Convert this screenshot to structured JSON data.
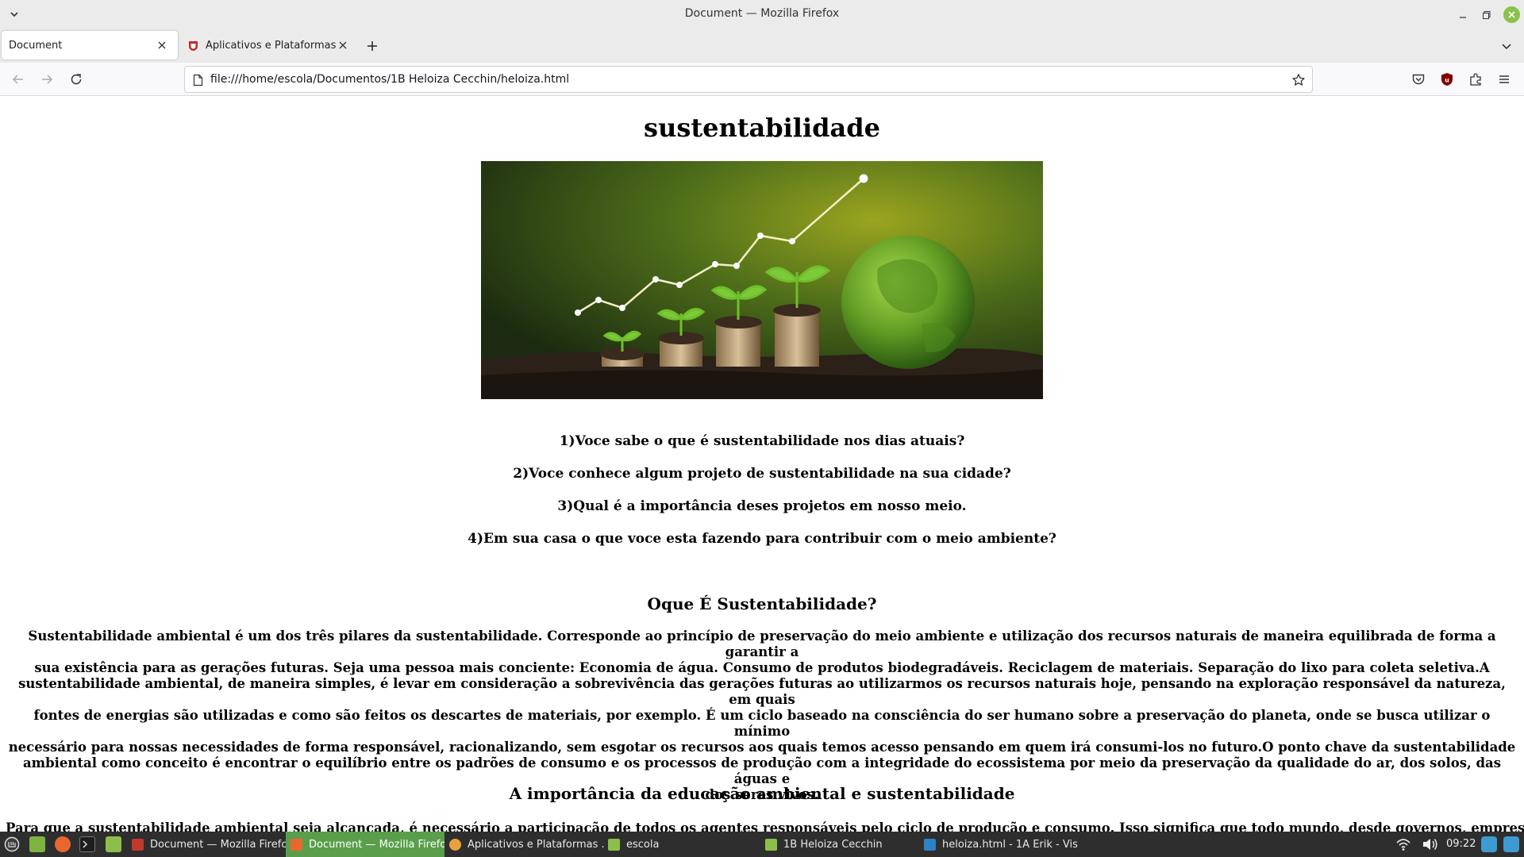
{
  "window": {
    "title": "Document — Mozilla Firefox"
  },
  "tabs": [
    {
      "label": "Document",
      "active": true
    },
    {
      "label": "Aplicativos e Plataformas E",
      "active": false
    }
  ],
  "navbar": {
    "url": "file:///home/escola/Documentos/1B Heloiza Cecchin/heloiza.html"
  },
  "page": {
    "heading": "sustentabilidade",
    "questions": [
      "1)Voce sabe o que é sustentabilidade nos dias atuais?",
      "2)Voce conhece algum projeto de sustentabilidade na sua cidade?",
      "3)Qual é a importância deses projetos em nosso meio.",
      "4)Em sua casa o que voce esta fazendo para contribuir com o meio ambiente?"
    ],
    "section1_title": "Oque É Sustentabilidade?",
    "section1_lines": [
      "Sustentabilidade ambiental é um dos três pilares da sustentabilidade. Corresponde ao princípio de preservação do meio ambiente e utilização dos recursos naturais de maneira equilibrada de forma a garantir a",
      "sua existência para as gerações futuras. Seja uma pessoa mais conciente: Economia de água. Consumo de produtos biodegradáveis. Reciclagem de materiais. Separação do lixo para coleta seletiva.A",
      "sustentabilidade ambiental, de maneira simples, é levar em consideração a sobrevivência das gerações futuras ao utilizarmos os recursos naturais hoje, pensando na exploração responsável da natureza, em quais",
      "fontes de energias são utilizadas e como são feitos os descartes de materiais, por exemplo. É um ciclo baseado na consciência do ser humano sobre a preservação do planeta, onde se busca utilizar o mínimo",
      "necessário para nossas necessidades de forma responsável, racionalizando, sem esgotar os recursos aos quais temos acesso pensando em quem irá consumi-los no futuro.O ponto chave da sustentabilidade",
      "ambiental como conceito é encontrar o equilíbrio entre os padrões de consumo e os processos de produção com a integridade do ecossistema por meio da preservação da qualidade do ar, dos solos, das águas e",
      "dos seres vivos."
    ],
    "section2_title": "A importância da educação ambiental e sustentabilidade",
    "section2_partial": "Para que a sustentabilidade ambiental seja alcançada, é necessário a participação de todos os agentes responsáveis pelo ciclo de produção e consumo. Isso significa que todo mundo, desde governos, empresas"
  },
  "taskbar": {
    "tasks": [
      {
        "label": "Document — Mozilla Firefox",
        "active": false
      },
      {
        "label": "Document — Mozilla Firefox",
        "active": true
      },
      {
        "label": "Aplicativos e Plataformas ...",
        "active": false
      },
      {
        "label": "escola",
        "active": false
      },
      {
        "label": "1B Heloiza Cecchin",
        "active": false
      },
      {
        "label": "heloiza.html - 1A Erik - Vis...",
        "active": false
      }
    ],
    "clock": "09:22"
  },
  "colors": {
    "active_task": "#5a9e4b",
    "taskbar_bg": "#2e2e2e",
    "close_button": "#8bc34a"
  }
}
